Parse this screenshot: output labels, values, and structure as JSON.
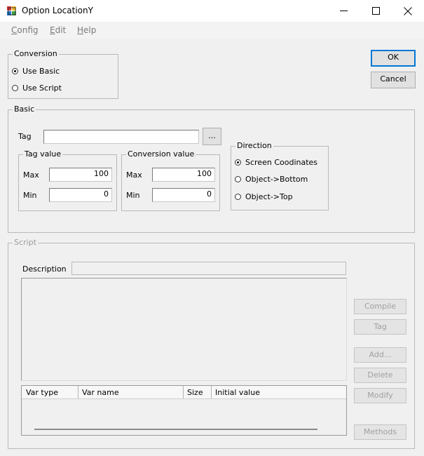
{
  "window": {
    "title": "Option LocationY",
    "minimize": "minimize",
    "maximize": "maximize",
    "close": "close"
  },
  "menu": [
    {
      "mnemonic": "C",
      "rest": "onfig"
    },
    {
      "mnemonic": "E",
      "rest": "dit"
    },
    {
      "mnemonic": "H",
      "rest": "elp"
    }
  ],
  "conversion": {
    "title": "Conversion",
    "options": [
      {
        "label": "Use Basic",
        "selected": true
      },
      {
        "label": "Use Script",
        "selected": false
      }
    ]
  },
  "buttons": {
    "ok": "OK",
    "cancel": "Cancel"
  },
  "basic": {
    "title": "Basic",
    "tag_label": "Tag",
    "tag_value": "",
    "browse_label": "...",
    "tag_value_group": {
      "title": "Tag value",
      "max_label": "Max",
      "max": "100",
      "min_label": "Min",
      "min": "0"
    },
    "conversion_value_group": {
      "title": "Conversion value",
      "max_label": "Max",
      "max": "100",
      "min_label": "Min",
      "min": "0"
    },
    "direction": {
      "title": "Direction",
      "options": [
        {
          "label": "Screen Coodinates",
          "selected": true
        },
        {
          "label": "Object->Bottom",
          "selected": false
        },
        {
          "label": "Object->Top",
          "selected": false
        }
      ]
    }
  },
  "script": {
    "title": "Script",
    "description_label": "Description",
    "description_value": "",
    "buttons": {
      "compile": "Compile",
      "tag": "Tag",
      "add": "Add...",
      "delete": "Delete",
      "modify": "Modify",
      "methods": "Methods"
    },
    "table_columns": [
      "Var type",
      "Var name",
      "Size",
      "Initial value"
    ]
  }
}
